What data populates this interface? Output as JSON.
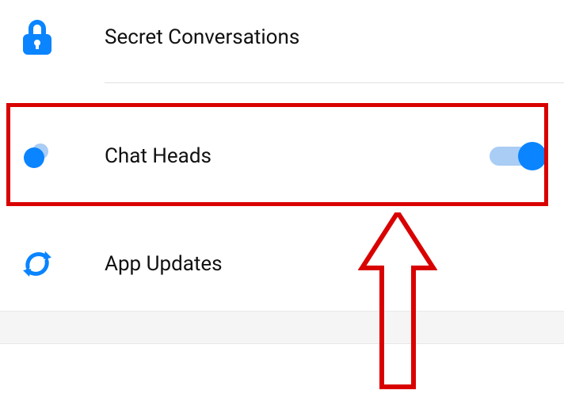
{
  "colors": {
    "accent": "#0a84ff",
    "annotation": "#d90000"
  },
  "rows": {
    "secret": {
      "label": "Secret Conversations"
    },
    "chat": {
      "label": "Chat Heads",
      "toggle": true
    },
    "appup": {
      "label": "App Updates"
    }
  }
}
